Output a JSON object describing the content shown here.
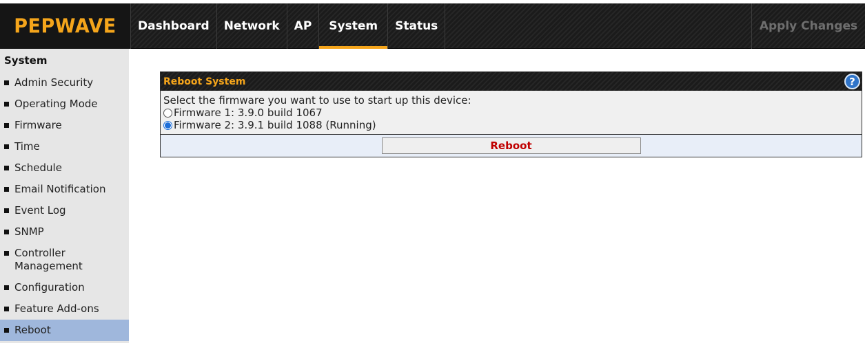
{
  "header": {
    "logo": "PEPWAVE",
    "tabs": [
      {
        "label": "Dashboard",
        "active": false
      },
      {
        "label": "Network",
        "active": false
      },
      {
        "label": "AP",
        "active": false
      },
      {
        "label": "System",
        "active": true
      },
      {
        "label": "Status",
        "active": false
      }
    ],
    "apply_label": "Apply Changes"
  },
  "sidebar": {
    "heading": "System",
    "items": [
      {
        "label": "Admin Security"
      },
      {
        "label": "Operating Mode"
      },
      {
        "label": "Firmware"
      },
      {
        "label": "Time"
      },
      {
        "label": "Schedule"
      },
      {
        "label": "Email Notification"
      },
      {
        "label": "Event Log"
      },
      {
        "label": "SNMP"
      },
      {
        "label": "Controller Management"
      },
      {
        "label": "Configuration"
      },
      {
        "label": "Feature Add-ons"
      },
      {
        "label": "Reboot",
        "active": true
      }
    ]
  },
  "panel": {
    "title": "Reboot System",
    "help_icon": "?",
    "prompt": "Select the firmware you want to use to start up this device:",
    "options": [
      {
        "label": "Firmware 1: 3.9.0 build 1067",
        "selected": false
      },
      {
        "label": "Firmware 2: 3.9.1 build 1088 (Running)",
        "selected": true
      }
    ],
    "reboot_label": "Reboot"
  },
  "colors": {
    "accent": "#f5a51b",
    "active_sidebar": "#9fb7dc",
    "reboot_text": "#c00000",
    "help_icon": "#2f74c9"
  }
}
